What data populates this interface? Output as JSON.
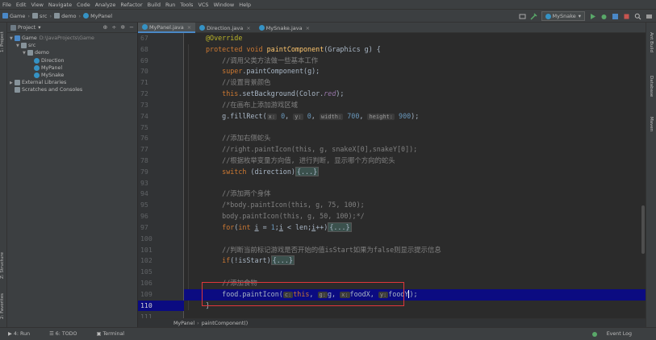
{
  "menu": [
    "File",
    "Edit",
    "View",
    "Navigate",
    "Code",
    "Analyze",
    "Refactor",
    "Build",
    "Run",
    "Tools",
    "VCS",
    "Window",
    "Help"
  ],
  "breadcrumb": [
    "Game",
    "src",
    "demo",
    "MyPanel"
  ],
  "run_config": "MySnake",
  "project_panel": {
    "title": "Project",
    "tree": [
      {
        "label": "Game",
        "path": "D:\\JavaProjects\\Game",
        "depth": 0,
        "arrow": "▼",
        "icon": "mod"
      },
      {
        "label": "src",
        "path": "",
        "depth": 1,
        "arrow": "▼",
        "icon": "folder"
      },
      {
        "label": "demo",
        "path": "",
        "depth": 2,
        "arrow": "▼",
        "icon": "folder"
      },
      {
        "label": "Direction",
        "path": "",
        "depth": 3,
        "arrow": "",
        "icon": "cls"
      },
      {
        "label": "MyPanel",
        "path": "",
        "depth": 3,
        "arrow": "",
        "icon": "cls"
      },
      {
        "label": "MySnake",
        "path": "",
        "depth": 3,
        "arrow": "",
        "icon": "cls"
      },
      {
        "label": "External Libraries",
        "path": "",
        "depth": 0,
        "arrow": "▶",
        "icon": "folder"
      },
      {
        "label": "Scratches and Consoles",
        "path": "",
        "depth": 0,
        "arrow": "",
        "icon": "folder"
      }
    ]
  },
  "left_tabs": [
    "1: Project",
    "Z: Structure",
    "2: Favorites"
  ],
  "right_tabs": [
    "Ant Build",
    "Database",
    "Maven"
  ],
  "tabs": [
    {
      "label": "MyPanel.java",
      "active": true
    },
    {
      "label": "Direction.java",
      "active": false
    },
    {
      "label": "MySnake.java",
      "active": false
    }
  ],
  "code_lines": [
    {
      "num": "67"
    },
    {
      "num": "68"
    },
    {
      "num": "69"
    },
    {
      "num": "70"
    },
    {
      "num": "71"
    },
    {
      "num": "72"
    },
    {
      "num": "73"
    },
    {
      "num": "74"
    },
    {
      "num": "75"
    },
    {
      "num": "76"
    },
    {
      "num": "77"
    },
    {
      "num": "78"
    },
    {
      "num": "79"
    },
    {
      "num": "93"
    },
    {
      "num": "94"
    },
    {
      "num": "95"
    },
    {
      "num": "96"
    },
    {
      "num": "97"
    },
    {
      "num": "100"
    },
    {
      "num": "101"
    },
    {
      "num": "102"
    },
    {
      "num": "105"
    },
    {
      "num": "106"
    },
    {
      "num": "109"
    },
    {
      "num": "110"
    },
    {
      "num": "111"
    }
  ],
  "code_text": {
    "l67": "@Override",
    "l69": "//调用父类方法做一些基本工作",
    "l71": "//设置背景颜色",
    "l73": "//在画布上添加游戏区域",
    "l76": "//添加右侧蛇头",
    "l77": "//right.paintIcon(this, g, snakeX[0],snakeY[0]);",
    "l78": "//根据枚举变量方向值, 进行判断, 显示哪个方向的蛇头",
    "l94": "//添加两个身体",
    "l95": "/*body.paintIcon(this, g, 75, 100);",
    "l96": "body.paintIcon(this, g, 50, 100);*/",
    "l101": "//判断当前标记游戏是否开始的值isStart如果为false则显示提示信息",
    "l109": "//添加食物"
  },
  "bottom_crumb": [
    "MyPanel",
    "paintComponent()"
  ],
  "status": {
    "run": "4: Run",
    "todo": "6: TODO",
    "terminal": "Terminal",
    "event_log": "Event Log"
  }
}
